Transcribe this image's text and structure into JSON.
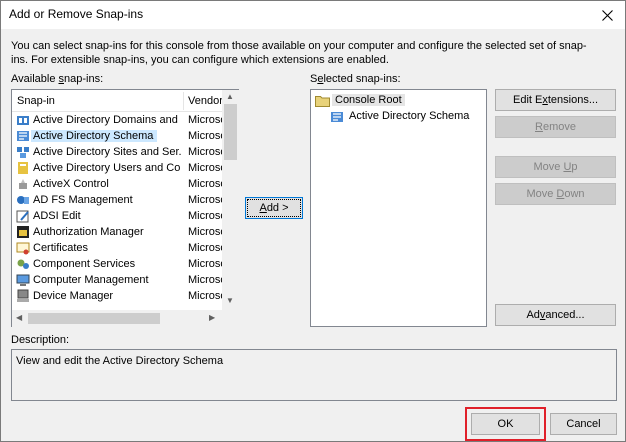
{
  "window": {
    "title": "Add or Remove Snap-ins",
    "close_icon": "close-icon"
  },
  "intro": "You can select snap-ins for this console from those available on your computer and configure the selected set of snap-ins. For extensible snap-ins, you can configure which extensions are enabled.",
  "available": {
    "label_pre": "Available ",
    "label_key": "s",
    "label_post": "nap-ins:",
    "col_snapin": "Snap-in",
    "col_vendor": "Vendor",
    "items": [
      {
        "name": "Active Directory Domains and ...",
        "vendor": "Microso",
        "icon": "ad-domains-icon",
        "selected": false
      },
      {
        "name": "Active Directory Schema",
        "vendor": "Microso",
        "icon": "ad-schema-icon",
        "selected": true
      },
      {
        "name": "Active Directory Sites and Ser...",
        "vendor": "Microso",
        "icon": "ad-sites-icon",
        "selected": false
      },
      {
        "name": "Active Directory Users and Co...",
        "vendor": "Microso",
        "icon": "ad-users-icon",
        "selected": false
      },
      {
        "name": "ActiveX Control",
        "vendor": "Microso",
        "icon": "activex-icon",
        "selected": false
      },
      {
        "name": "AD FS Management",
        "vendor": "Microso",
        "icon": "adfs-icon",
        "selected": false
      },
      {
        "name": "ADSI Edit",
        "vendor": "Microso",
        "icon": "adsi-edit-icon",
        "selected": false
      },
      {
        "name": "Authorization Manager",
        "vendor": "Microso",
        "icon": "authorization-icon",
        "selected": false
      },
      {
        "name": "Certificates",
        "vendor": "Microso",
        "icon": "certificates-icon",
        "selected": false
      },
      {
        "name": "Component Services",
        "vendor": "Microso",
        "icon": "component-services-icon",
        "selected": false
      },
      {
        "name": "Computer Management",
        "vendor": "Microso",
        "icon": "computer-management-icon",
        "selected": false
      },
      {
        "name": "Device Manager",
        "vendor": "Microso",
        "icon": "device-manager-icon",
        "selected": false
      }
    ]
  },
  "add_button": {
    "pre": "",
    "key": "A",
    "post": "dd >"
  },
  "selected": {
    "label_pre": "S",
    "label_key": "e",
    "label_post": "lected snap-ins:",
    "root": "Console Root",
    "child": "Active Directory Schema"
  },
  "buttons": {
    "edit_ext": {
      "pre": "Edit E",
      "key": "x",
      "post": "tensions..."
    },
    "remove": {
      "pre": "",
      "key": "R",
      "post": "emove"
    },
    "move_up": {
      "pre": "Move ",
      "key": "U",
      "post": "p"
    },
    "move_down": {
      "pre": "Move ",
      "key": "D",
      "post": "own"
    },
    "advanced": {
      "pre": "Ad",
      "key": "v",
      "post": "anced..."
    },
    "ok": "OK",
    "cancel": "Cancel"
  },
  "description": {
    "label": "Description:",
    "text": "View and edit the Active Directory Schema"
  },
  "colors": {
    "selection": "#cce8ff",
    "highlight_box": "#e0202a",
    "focus_border": "#0078d7"
  }
}
